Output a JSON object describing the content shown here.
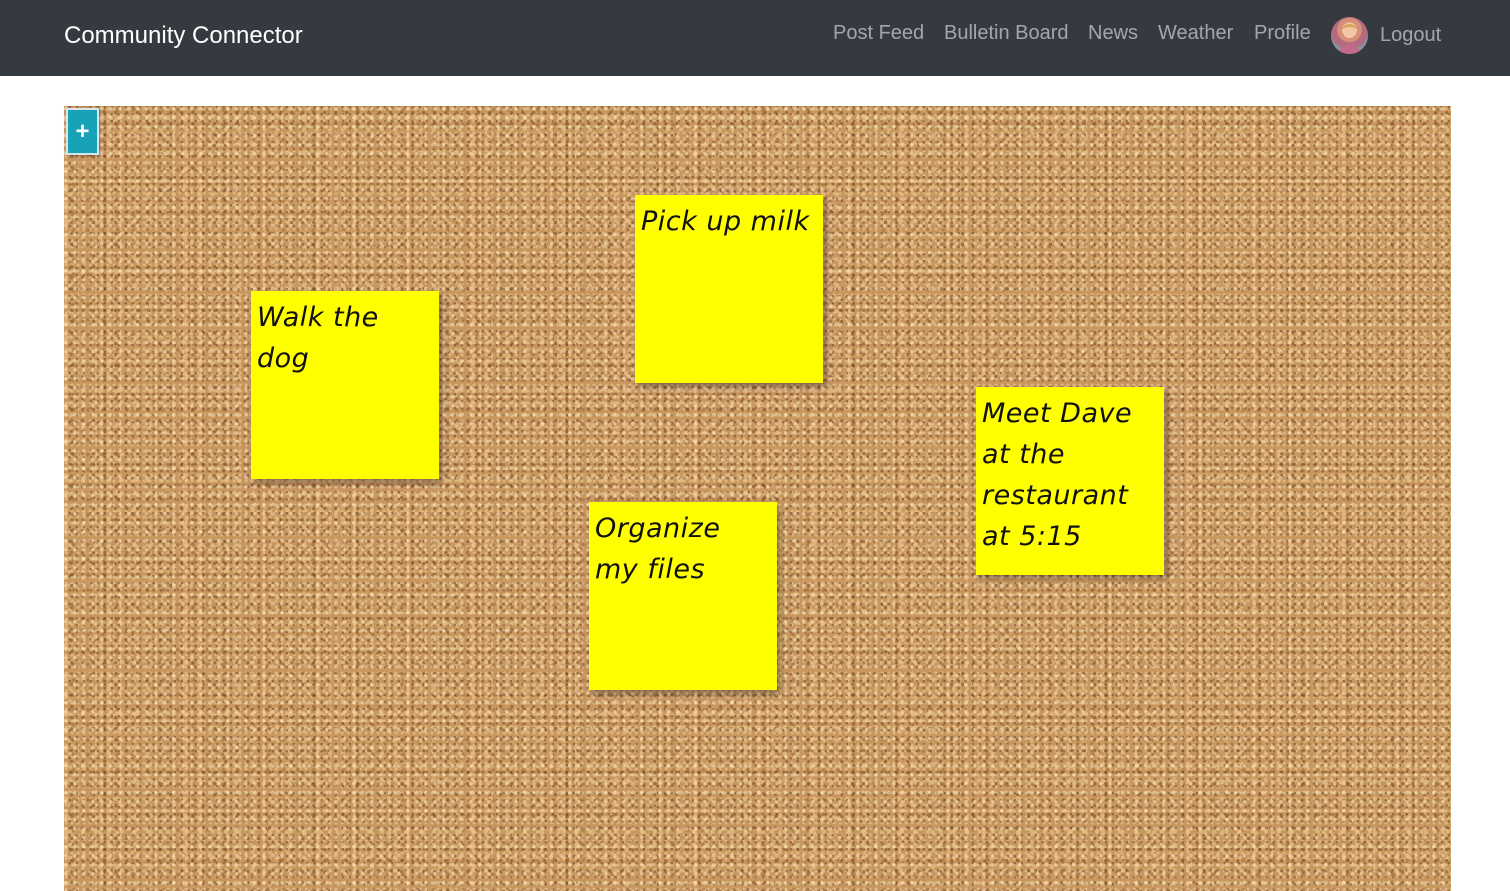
{
  "brand": "Community Connector",
  "nav": {
    "post_feed": "Post Feed",
    "bulletin_board": "Bulletin Board",
    "news": "News",
    "weather": "Weather",
    "profile": "Profile",
    "logout": "Logout"
  },
  "board": {
    "add_button_label": "+",
    "notes": [
      {
        "text": "Walk the dog"
      },
      {
        "text": "Pick up milk"
      },
      {
        "text": "Organize my files"
      },
      {
        "text": "Meet Dave at the restaurant at 5:15"
      }
    ]
  },
  "colors": {
    "navbar": "#343a40",
    "accent": "#17a2b8",
    "note": "#ffff00",
    "cork": "#c8965f"
  },
  "icons": {
    "avatar": "user-avatar",
    "add": "plus-icon"
  }
}
